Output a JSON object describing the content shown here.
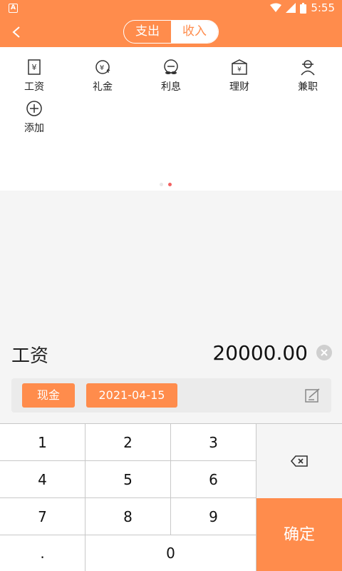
{
  "status": {
    "time": "5:55",
    "notification_badge": "A"
  },
  "header": {
    "back_label": "<",
    "tabs": [
      {
        "label": "支出"
      },
      {
        "label": "收入"
      }
    ],
    "active_tab": "收入"
  },
  "categories": [
    {
      "label": "工资",
      "icon": "salary-icon"
    },
    {
      "label": "礼金",
      "icon": "gift-money-icon"
    },
    {
      "label": "利息",
      "icon": "interest-icon"
    },
    {
      "label": "理财",
      "icon": "investment-icon"
    },
    {
      "label": "兼职",
      "icon": "part-time-icon"
    },
    {
      "label": "添加",
      "icon": "add-icon"
    }
  ],
  "pager": {
    "pages": 2,
    "current": 2
  },
  "entry": {
    "category": "工资",
    "amount": "20000.00"
  },
  "meta": {
    "account": "现金",
    "date": "2021-04-15"
  },
  "keypad": {
    "keys": [
      "1",
      "2",
      "3",
      "4",
      "5",
      "6",
      "7",
      "8",
      "9",
      ".",
      "0"
    ],
    "confirm_label": "确定"
  },
  "colors": {
    "accent": "#ff8c4c",
    "pager_active": "#f26161"
  }
}
